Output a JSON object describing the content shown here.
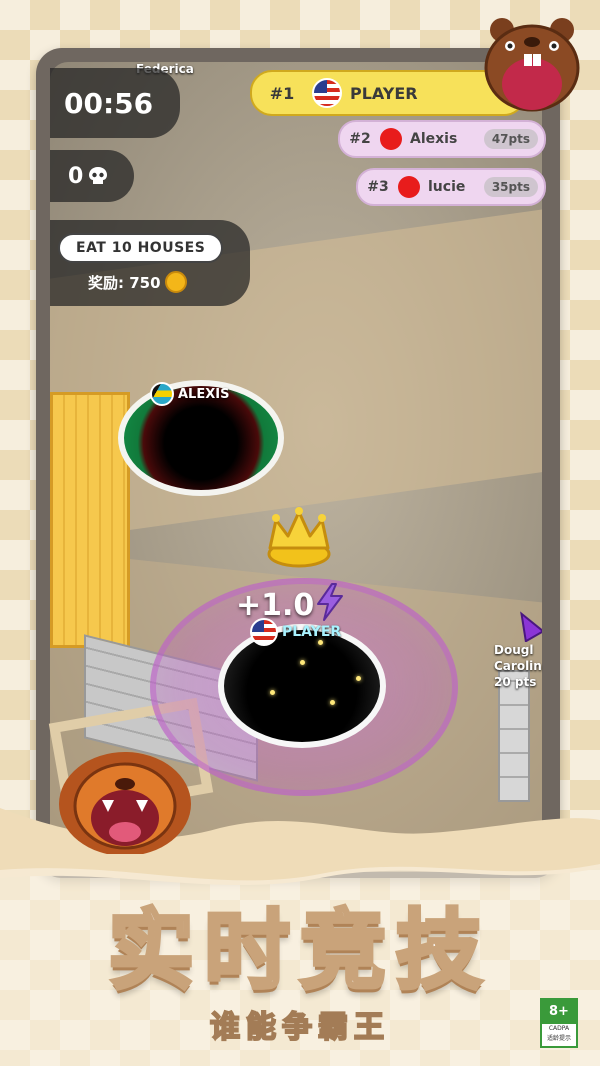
{
  "hud": {
    "timer": "00:56",
    "kills": "0",
    "top_name": "Federica",
    "quest_label": "EAT 10 HOUSES",
    "quest_reward": "奖励: 750"
  },
  "leaderboard": [
    {
      "rank": "#1",
      "name": "PLAYER",
      "pts": ""
    },
    {
      "rank": "#2",
      "name": "Alexis",
      "pts": "47pts"
    },
    {
      "rank": "#3",
      "name": "lucie",
      "pts": "35pts"
    }
  ],
  "players": {
    "alexis_label": "ALEXIS",
    "player_label": "PLAYER",
    "score_popup": "+1.0",
    "offscreen_name_1": "Dougl",
    "offscreen_name_2": "Carolin",
    "offscreen_pts": "20 pts"
  },
  "banner": {
    "title": "实时竞技",
    "subtitle": "谁能争霸王"
  },
  "rating": {
    "age": "8+",
    "org": "CADPA",
    "note": "适龄提示"
  },
  "colors": {
    "leader_gold": "#f7e15a",
    "row_pink": "#efd6f0",
    "player_hole_ring": "#2ddf47",
    "aura_purple": "#c06ed2"
  }
}
